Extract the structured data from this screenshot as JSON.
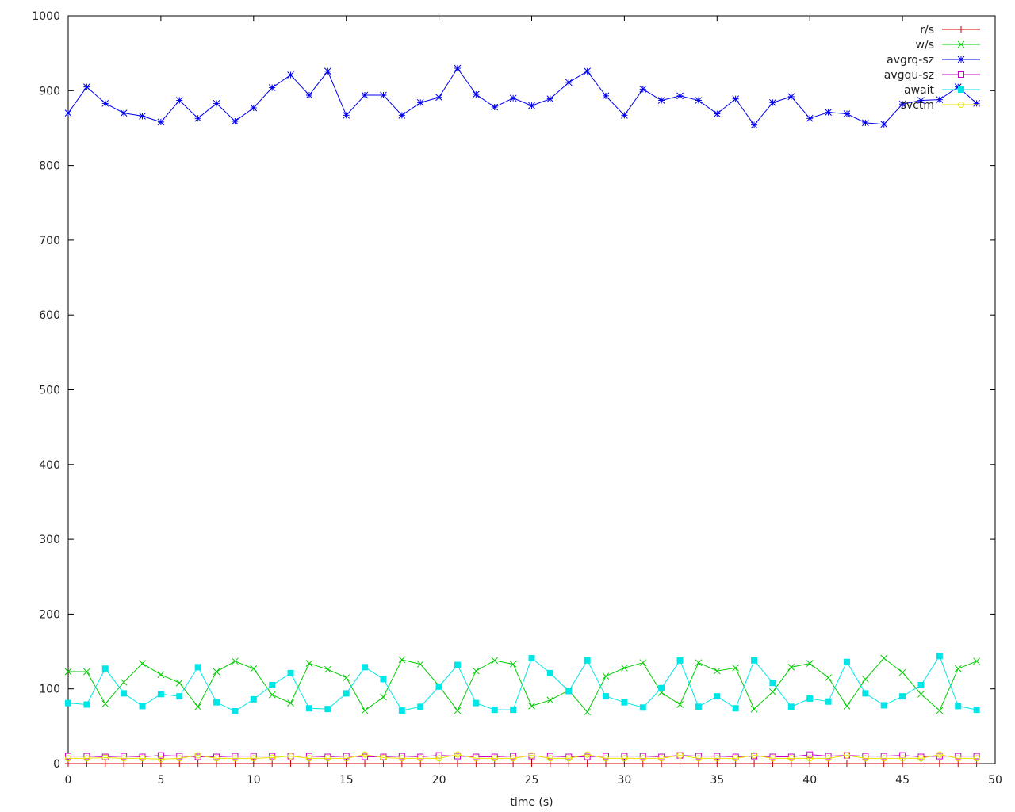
{
  "chart_data": {
    "type": "line",
    "xlabel": "time (s)",
    "ylabel": "",
    "title": "",
    "xlim": [
      0,
      50
    ],
    "ylim": [
      0,
      1000
    ],
    "xticks": [
      0,
      5,
      10,
      15,
      20,
      25,
      30,
      35,
      40,
      45,
      50
    ],
    "yticks": [
      0,
      100,
      200,
      300,
      400,
      500,
      600,
      700,
      800,
      900,
      1000
    ],
    "grid": false,
    "legend_position": "top-right",
    "x": [
      0,
      1,
      2,
      3,
      4,
      5,
      6,
      7,
      8,
      9,
      10,
      11,
      12,
      13,
      14,
      15,
      16,
      17,
      18,
      19,
      20,
      21,
      22,
      23,
      24,
      25,
      26,
      27,
      28,
      29,
      30,
      31,
      32,
      33,
      34,
      35,
      36,
      37,
      38,
      39,
      40,
      41,
      42,
      43,
      44,
      45,
      46,
      47,
      48,
      49
    ],
    "series": [
      {
        "name": "r/s",
        "color": "#cc0000",
        "marker": "plus",
        "values": [
          0,
          0,
          0,
          0,
          0,
          0,
          0,
          0,
          0,
          0,
          0,
          0,
          0,
          0,
          0,
          0,
          0,
          0,
          0,
          0,
          0,
          0,
          0,
          0,
          0,
          0,
          0,
          0,
          0,
          0,
          0,
          0,
          0,
          0,
          0,
          0,
          0,
          0,
          0,
          0,
          0,
          0,
          0,
          0,
          0,
          0,
          0,
          0,
          0,
          0
        ]
      },
      {
        "name": "w/s",
        "color": "#00cc00",
        "marker": "x",
        "values": [
          123,
          123,
          80,
          109,
          134,
          119,
          108,
          76,
          123,
          137,
          127,
          92,
          81,
          134,
          126,
          115,
          71,
          89,
          139,
          133,
          104,
          71,
          124,
          138,
          133,
          77,
          85,
          98,
          69,
          117,
          128,
          135,
          95,
          79,
          135,
          124,
          128,
          73,
          96,
          129,
          134,
          115,
          77,
          113,
          141,
          122,
          93,
          71,
          127,
          137
        ]
      },
      {
        "name": "avgrq-sz",
        "color": "#0000ee",
        "marker": "star",
        "values": [
          870,
          905,
          883,
          870,
          866,
          858,
          887,
          863,
          883,
          859,
          877,
          904,
          921,
          894,
          926,
          867,
          894,
          894,
          867,
          884,
          891,
          930,
          895,
          878,
          890,
          880,
          889,
          911,
          926,
          893,
          867,
          902,
          887,
          893,
          887,
          869,
          889,
          854,
          884,
          892,
          863,
          871,
          869,
          857,
          855,
          882,
          887,
          888,
          905,
          883
        ]
      },
      {
        "name": "avgqu-sz",
        "color": "#cc00cc",
        "marker": "open-square",
        "values": [
          10,
          10,
          9,
          10,
          9,
          11,
          10,
          9,
          9,
          10,
          10,
          10,
          10,
          10,
          9,
          10,
          9,
          9,
          10,
          9,
          11,
          10,
          9,
          9,
          10,
          10,
          10,
          9,
          9,
          10,
          10,
          10,
          9,
          11,
          10,
          10,
          9,
          10,
          9,
          9,
          12,
          10,
          11,
          10,
          10,
          11,
          9,
          10,
          10,
          10
        ]
      },
      {
        "name": "await",
        "color": "#00e6e6",
        "marker": "filled-square",
        "values": [
          81,
          79,
          127,
          94,
          77,
          93,
          90,
          129,
          82,
          70,
          86,
          105,
          121,
          74,
          73,
          94,
          129,
          113,
          71,
          76,
          103,
          132,
          81,
          72,
          72,
          141,
          121,
          97,
          138,
          90,
          82,
          75,
          101,
          138,
          76,
          90,
          74,
          138,
          108,
          76,
          87,
          83,
          136,
          94,
          78,
          90,
          105,
          144,
          77,
          72
        ]
      },
      {
        "name": "svctm",
        "color": "#e6e600",
        "marker": "circle",
        "values": [
          7,
          7,
          8,
          7,
          7,
          6,
          7,
          11,
          7,
          7,
          7,
          8,
          10,
          7,
          7,
          7,
          12,
          8,
          7,
          7,
          7,
          12,
          7,
          7,
          7,
          11,
          7,
          7,
          12,
          7,
          7,
          7,
          7,
          11,
          7,
          7,
          7,
          11,
          7,
          7,
          7,
          7,
          11,
          7,
          7,
          7,
          7,
          12,
          7,
          7
        ]
      }
    ]
  }
}
